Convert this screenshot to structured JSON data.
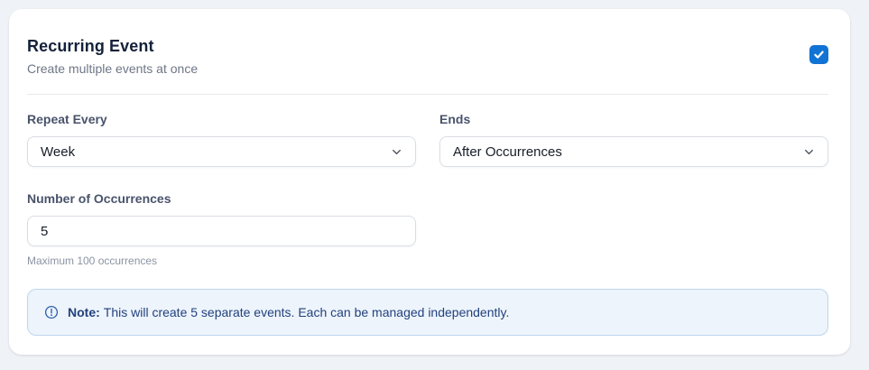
{
  "card": {
    "title": "Recurring Event",
    "subtitle": "Create multiple events at once",
    "enabled_checkbox": {
      "checked": true
    }
  },
  "form": {
    "repeat_every": {
      "label": "Repeat Every",
      "value": "Week"
    },
    "ends": {
      "label": "Ends",
      "value": "After Occurrences"
    },
    "occurrences": {
      "label": "Number of Occurrences",
      "value": "5",
      "helper": "Maximum 100 occurrences"
    }
  },
  "note": {
    "icon": "info-circle-icon",
    "prefix": "Note:",
    "text": "This will create 5 separate events. Each can be managed independently."
  },
  "colors": {
    "accent": "#1173d4",
    "page_background": "#eff2f6",
    "note_background": "#edf4fb",
    "note_border": "#bcd6ee",
    "note_text": "#23417d"
  }
}
